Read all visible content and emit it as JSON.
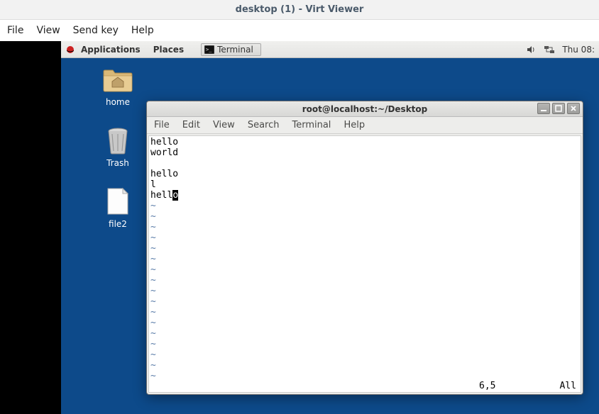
{
  "virt": {
    "title": "desktop (1) - Virt Viewer",
    "menu": {
      "file": "File",
      "view": "View",
      "sendkey": "Send key",
      "help": "Help"
    }
  },
  "gnome": {
    "topbar": {
      "applications": "Applications",
      "places": "Places",
      "task": "Terminal",
      "clock": "Thu 08:"
    },
    "icons": {
      "home": "home",
      "trash": "Trash",
      "file2": "file2"
    }
  },
  "terminal": {
    "title": "root@localhost:~/Desktop",
    "menu": {
      "file": "File",
      "edit": "Edit",
      "view": "View",
      "search": "Search",
      "terminal": "Terminal",
      "help": "Help"
    },
    "lines": {
      "l0": "hello",
      "l1": "world",
      "l2": "",
      "l3": "hello",
      "l4": "l",
      "l5a": "hell",
      "l5b": "o"
    },
    "status": {
      "pos": "6,5",
      "all": "All"
    }
  }
}
